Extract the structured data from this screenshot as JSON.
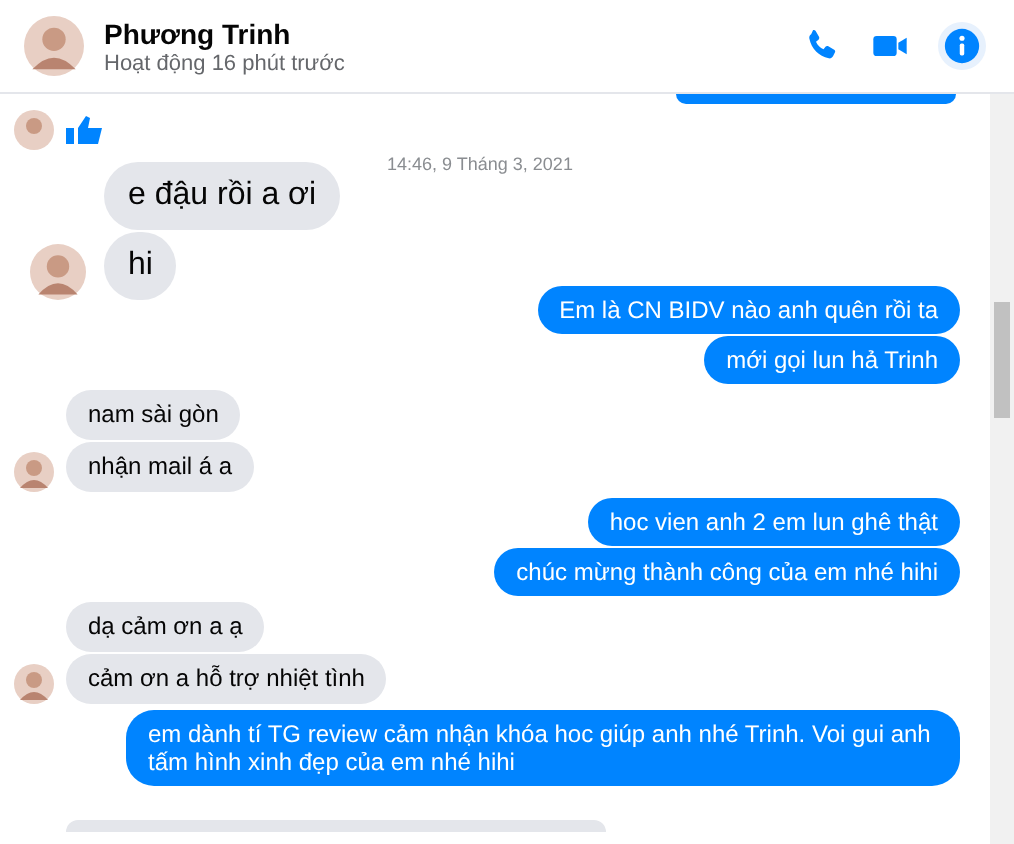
{
  "header": {
    "name": "Phương Trinh",
    "status": "Hoạt động 16 phút trước"
  },
  "messages": [
    {
      "kind": "cut_me"
    },
    {
      "kind": "like",
      "show_avatar": true
    },
    {
      "kind": "timestamp",
      "text": "14:46, 9 Tháng 3, 2021"
    },
    {
      "kind": "them_large",
      "text": "e đậu rồi a ơi",
      "show_avatar": false
    },
    {
      "kind": "them_large",
      "text": "hi",
      "show_avatar": true
    },
    {
      "kind": "me",
      "text": "Em là CN BIDV nào anh quên rồi ta"
    },
    {
      "kind": "me",
      "text": "mới gọi lun hả Trinh"
    },
    {
      "kind": "them",
      "text": "nam sài gòn",
      "show_avatar": false
    },
    {
      "kind": "them",
      "text": "nhận mail á a",
      "show_avatar": true
    },
    {
      "kind": "me",
      "text": "hoc vien anh 2 em lun ghê thật"
    },
    {
      "kind": "me",
      "text": "chúc mừng thành công của em nhé hihi"
    },
    {
      "kind": "them",
      "text": "dạ cảm ơn a ạ",
      "show_avatar": false
    },
    {
      "kind": "them",
      "text": "cảm ơn a hỗ trợ nhiệt tình",
      "show_avatar": true
    },
    {
      "kind": "me",
      "text": "em dành tí TG review cảm nhận khóa hoc giúp anh nhé Trinh. Voi gui anh tấm hình xinh đẹp của em nhé hihi"
    },
    {
      "kind": "cut_them"
    }
  ]
}
